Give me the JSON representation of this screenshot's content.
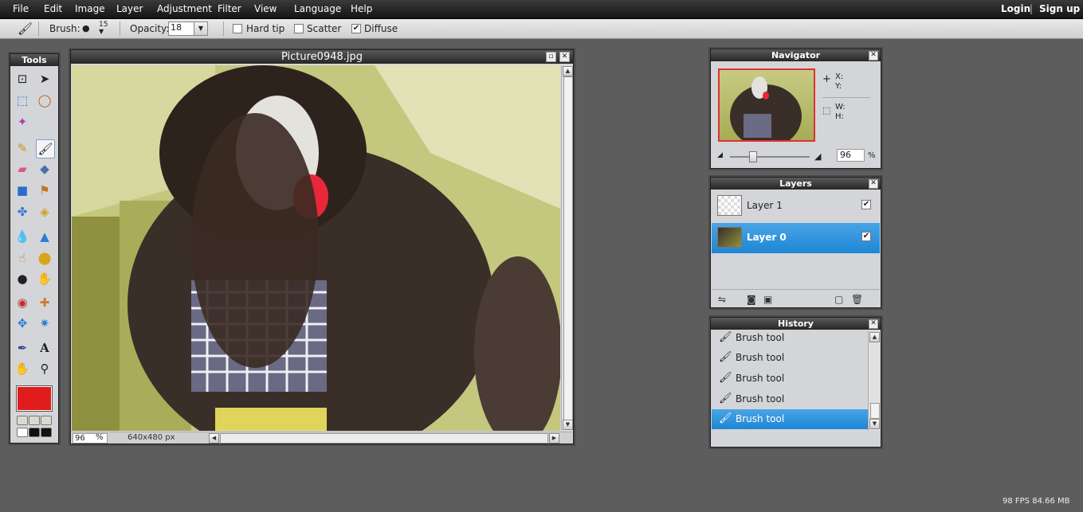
{
  "menu": {
    "items": [
      "File",
      "Edit",
      "Image",
      "Layer",
      "Adjustment",
      "Filter",
      "View",
      "Language",
      "Help"
    ],
    "login": "Login",
    "separator": "|",
    "signup": "Sign up"
  },
  "options": {
    "brush_label": "Brush:",
    "brush_size": "15",
    "opacity_label": "Opacity:",
    "opacity_value": "18",
    "hard_tip_label": "Hard tip",
    "hard_tip_checked": false,
    "scatter_label": "Scatter",
    "scatter_checked": false,
    "diffuse_label": "Diffuse",
    "diffuse_checked": true
  },
  "tools": {
    "title": "Tools",
    "foreground_color": "#e11c1c"
  },
  "document": {
    "title": "Picture0948.jpg",
    "zoom": "96",
    "zoom_unit": "%",
    "dimensions": "640x480 px"
  },
  "navigator": {
    "title": "Navigator",
    "x_label": "X:",
    "y_label": "Y:",
    "w_label": "W:",
    "h_label": "H:",
    "zoom": "96",
    "zoom_unit": "%"
  },
  "layers": {
    "title": "Layers",
    "items": [
      {
        "name": "Layer 1",
        "visible": true,
        "selected": false
      },
      {
        "name": "Layer 0",
        "visible": true,
        "selected": true
      }
    ]
  },
  "history": {
    "title": "History",
    "items": [
      "Brush tool",
      "Brush tool",
      "Brush tool",
      "Brush tool",
      "Brush tool"
    ],
    "selected_index": 4
  },
  "status": "98 FPS 84.66 MB",
  "colors": {
    "selection_blue": "#1e86d4",
    "foreground": "#e11c1c"
  }
}
